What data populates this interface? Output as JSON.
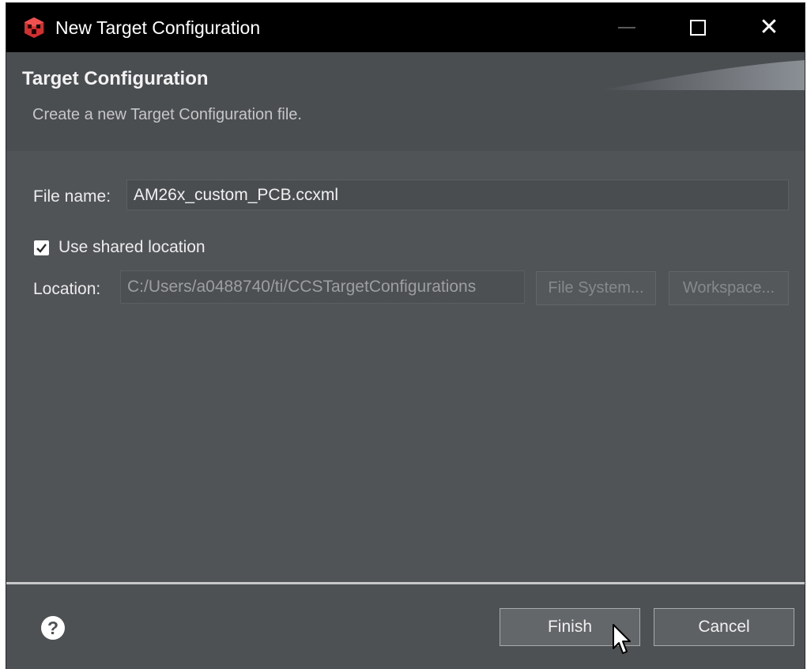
{
  "window": {
    "title": "New Target Configuration"
  },
  "banner": {
    "title": "Target Configuration",
    "description": "Create a new Target Configuration file."
  },
  "form": {
    "file_name_label": "File name:",
    "file_name_value": "AM26x_custom_PCB.ccxml",
    "use_shared_location_label": "Use shared location",
    "use_shared_location_checked": true,
    "location_label": "Location:",
    "location_value": "C:/Users/a0488740/ti/CCSTargetConfigurations",
    "file_system_button": "File System...",
    "workspace_button": "Workspace..."
  },
  "footer": {
    "finish_button": "Finish",
    "cancel_button": "Cancel",
    "help_icon": "question-mark-icon"
  },
  "colors": {
    "dialog_background": "#4c4f52",
    "titlebar_background": "#000000",
    "separator": "#c7c9cb",
    "app_icon_red": "#d32f2f"
  }
}
